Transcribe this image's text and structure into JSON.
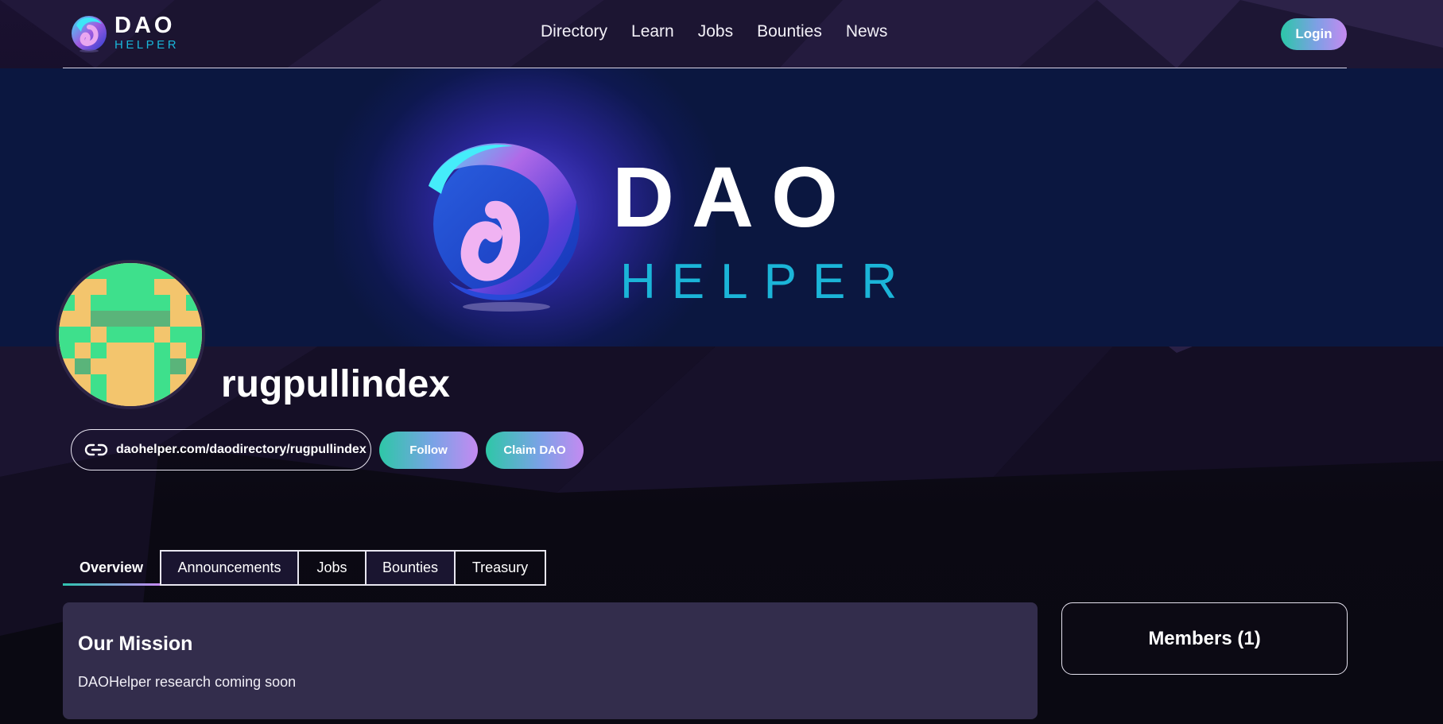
{
  "brand": {
    "logo_word": "DAO",
    "logo_sub": "HELPER"
  },
  "nav": {
    "items": [
      "Directory",
      "Learn",
      "Jobs",
      "Bounties",
      "News"
    ],
    "login_label": "Login"
  },
  "banner": {
    "word": "DAO",
    "sub": "HELPER"
  },
  "profile": {
    "name": "rugpullindex",
    "url": "daohelper.com/daodirectory/rugpullindex",
    "follow_label": "Follow",
    "claim_label": "Claim DAO"
  },
  "tabs": [
    "Overview",
    "Announcements",
    "Jobs",
    "Bounties",
    "Treasury"
  ],
  "mission": {
    "title": "Our Mission",
    "text": "DAOHelper research coming soon"
  },
  "members": {
    "label": "Members (1)"
  },
  "colors": {
    "accent_teal": "#2ec7a7",
    "accent_purple": "#c48af1",
    "brand_cyan": "#1bb5d8",
    "banner_bg": "#0b1740",
    "card_bg": "#332d4c"
  }
}
